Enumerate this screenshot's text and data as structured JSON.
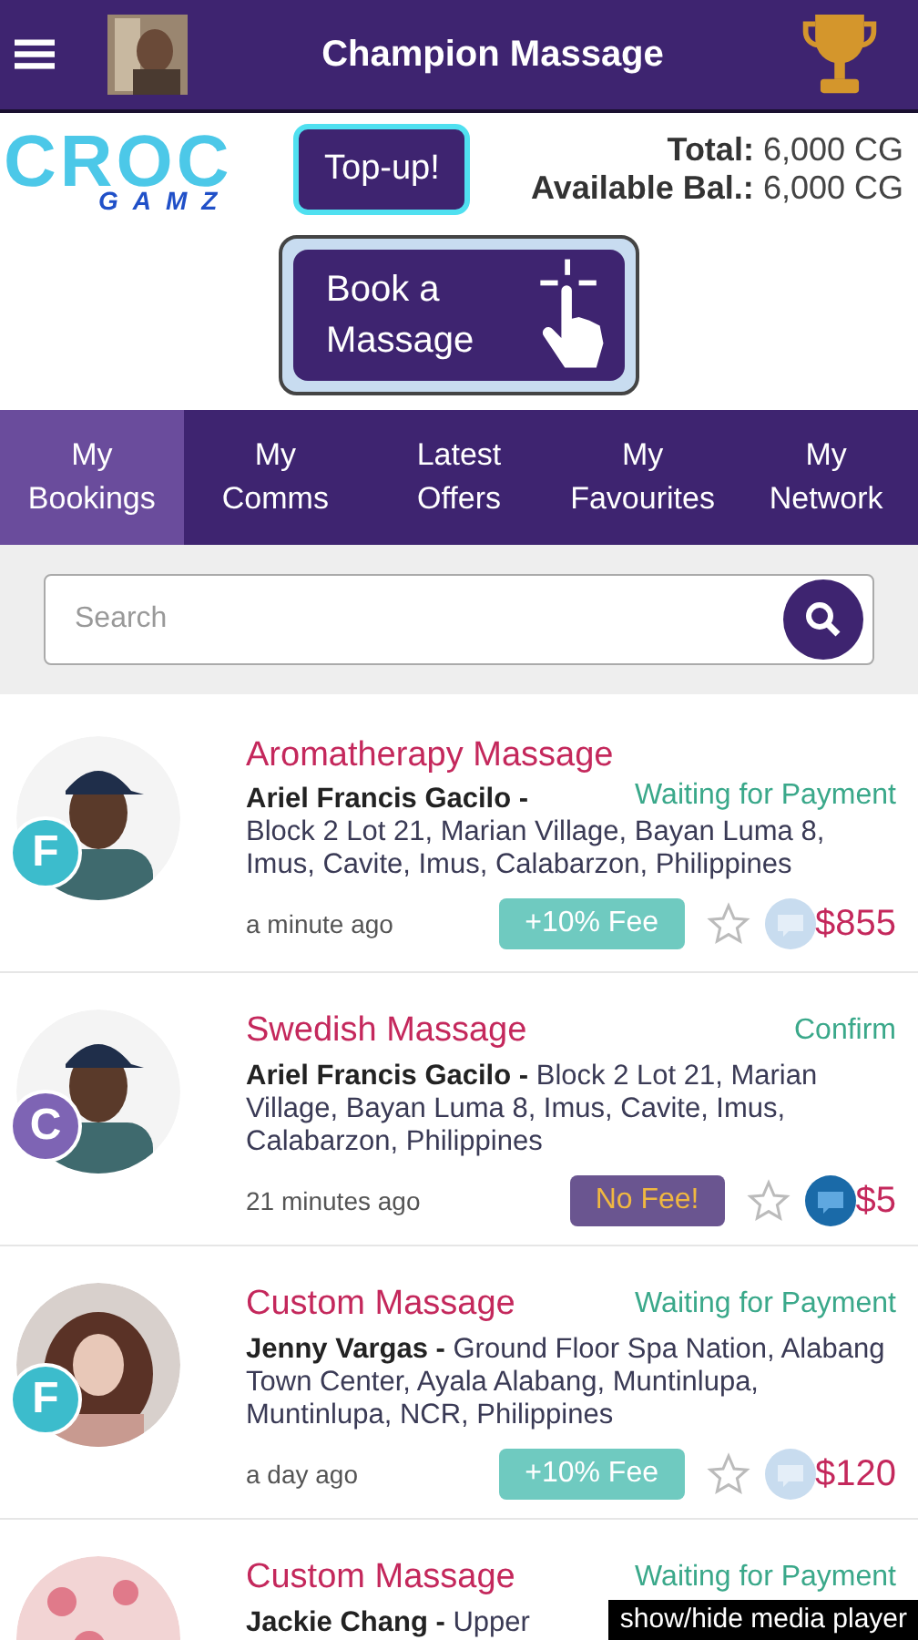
{
  "header": {
    "title": "Champion Massage"
  },
  "logo": {
    "top": "CROC",
    "bottom": "GAMZ"
  },
  "topup_button": "Top-up!",
  "balance": [
    {
      "label": "Total:",
      "value": "6,000 CG"
    },
    {
      "label": "Available Bal.:",
      "value": "6,000 CG"
    }
  ],
  "book_button": [
    "Book a",
    "Massage"
  ],
  "tabs": [
    {
      "label": [
        "My",
        "Bookings"
      ],
      "selected": true
    },
    {
      "label": [
        "My",
        "Comms"
      ],
      "selected": false
    },
    {
      "label": [
        "Latest",
        "Offers"
      ],
      "selected": false
    },
    {
      "label": [
        "My",
        "Favourites"
      ],
      "selected": false
    },
    {
      "label": [
        "My",
        "Network"
      ],
      "selected": false
    }
  ],
  "search": {
    "placeholder": "Search"
  },
  "bookings": [
    {
      "service": "Aromatherapy Massage",
      "status": "Waiting for Payment",
      "name": "Ariel Francis Gacilo -",
      "address": "Block 2 Lot 21, Marian Village, Bayan Luma 8, Imus, Cavite, Imus, Calabarzon, Philippines",
      "name_block": true,
      "time": "a minute ago",
      "fee": {
        "kind": "fee",
        "label": "+10% Fee"
      },
      "badge": {
        "letter": "F",
        "color": "#3cbccc"
      },
      "chat_active": false,
      "price": "$855"
    },
    {
      "service": "Swedish Massage",
      "status": "Confirm",
      "name": "Ariel Francis Gacilo -",
      "address": "Block 2 Lot 21, Marian Village, Bayan Luma 8, Imus, Cavite, Imus, Calabarzon, Philippines",
      "name_block": false,
      "time": "21 minutes ago",
      "fee": {
        "kind": "nofee",
        "label": "No Fee!"
      },
      "badge": {
        "letter": "C",
        "color": "#7e64b4"
      },
      "chat_active": true,
      "price": "$5"
    },
    {
      "service": "Custom Massage",
      "status": "Waiting for Payment",
      "name": "Jenny Vargas -",
      "address": "Ground Floor Spa Nation, Alabang Town Center, Ayala Alabang, Muntinlupa, Muntinlupa, NCR, Philippines",
      "name_block": false,
      "time": "a day ago",
      "fee": {
        "kind": "fee",
        "label": "+10% Fee"
      },
      "badge": {
        "letter": "F",
        "color": "#3cbccc"
      },
      "chat_active": false,
      "price": "$120"
    },
    {
      "service": "Custom Massage",
      "status": "Waiting for Payment",
      "name": "Jackie Chang -",
      "address": "Upper",
      "name_block": false
    }
  ],
  "overlay": "show/hide media player"
}
